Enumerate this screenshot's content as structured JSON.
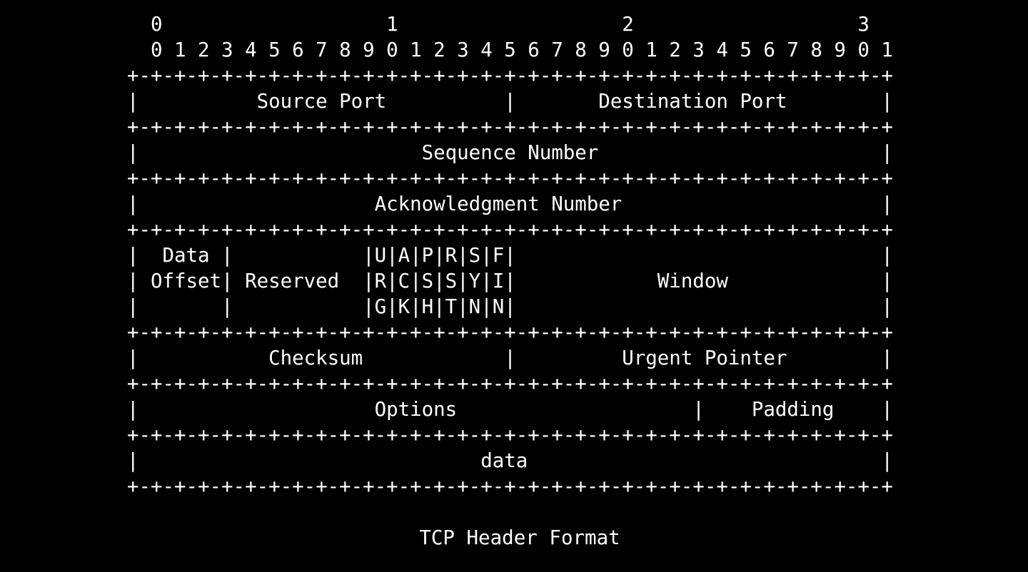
{
  "diagram": {
    "bit_ruler_tens": "  0                   1                   2                   3",
    "bit_ruler_units": "  0 1 2 3 4 5 6 7 8 9 0 1 2 3 4 5 6 7 8 9 0 1 2 3 4 5 6 7 8 9 0 1",
    "rows": [
      "+-+-+-+-+-+-+-+-+-+-+-+-+-+-+-+-+-+-+-+-+-+-+-+-+-+-+-+-+-+-+-+-+",
      "|          Source Port          |       Destination Port        |",
      "+-+-+-+-+-+-+-+-+-+-+-+-+-+-+-+-+-+-+-+-+-+-+-+-+-+-+-+-+-+-+-+-+",
      "|                        Sequence Number                        |",
      "+-+-+-+-+-+-+-+-+-+-+-+-+-+-+-+-+-+-+-+-+-+-+-+-+-+-+-+-+-+-+-+-+",
      "|                    Acknowledgment Number                      |",
      "+-+-+-+-+-+-+-+-+-+-+-+-+-+-+-+-+-+-+-+-+-+-+-+-+-+-+-+-+-+-+-+-+",
      "|  Data |           |U|A|P|R|S|F|                               |",
      "| Offset| Reserved  |R|C|S|S|Y|I|            Window             |",
      "|       |           |G|K|H|T|N|N|                               |",
      "+-+-+-+-+-+-+-+-+-+-+-+-+-+-+-+-+-+-+-+-+-+-+-+-+-+-+-+-+-+-+-+-+",
      "|           Checksum            |         Urgent Pointer        |",
      "+-+-+-+-+-+-+-+-+-+-+-+-+-+-+-+-+-+-+-+-+-+-+-+-+-+-+-+-+-+-+-+-+",
      "|                    Options                    |    Padding    |",
      "+-+-+-+-+-+-+-+-+-+-+-+-+-+-+-+-+-+-+-+-+-+-+-+-+-+-+-+-+-+-+-+-+",
      "|                             data                              |",
      "+-+-+-+-+-+-+-+-+-+-+-+-+-+-+-+-+-+-+-+-+-+-+-+-+-+-+-+-+-+-+-+-+"
    ]
  },
  "caption": "TCP Header Format",
  "colors": {
    "background": "#000000",
    "text": "#ffffff"
  }
}
